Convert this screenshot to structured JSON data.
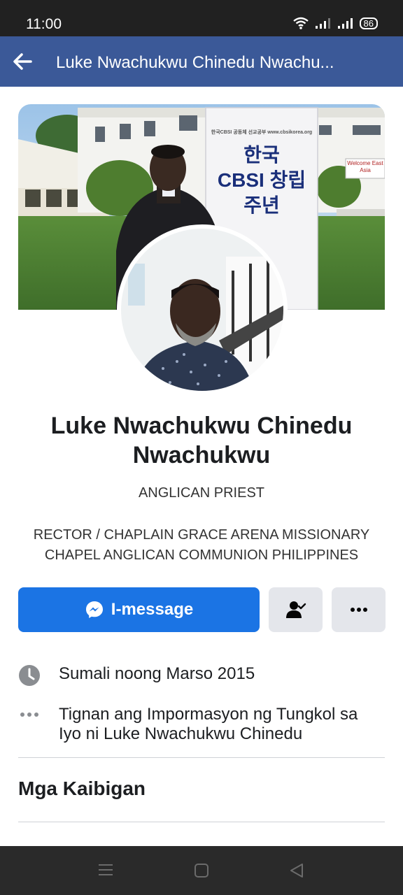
{
  "status_bar": {
    "time": "11:00",
    "battery": "86"
  },
  "header": {
    "title": "Luke Nwachukwu Chinedu Nwachu..."
  },
  "cover": {
    "sign_line1": "한국",
    "sign_line2": "CBSI 창립",
    "sign_line3": "주년",
    "sign_top": "한국CBSI 공동체 선교공부   www.cbsikorea.org",
    "building_sign": "Welcome East Asia"
  },
  "profile": {
    "name": "Luke Nwachukwu Chinedu Nwachukwu",
    "subtitle": "ANGLICAN PRIEST",
    "bio": "RECTOR / CHAPLAIN GRACE ARENA MISSIONARY CHAPEL ANGLICAN COMMUNION PHILIPPINES"
  },
  "actions": {
    "message_label": "I-message"
  },
  "info": [
    {
      "icon": "clock-icon",
      "text": "Sumali noong Marso 2015"
    },
    {
      "icon": "more-dots-icon",
      "text": "Tignan ang Impormasyon ng Tungkol sa Iyo ni Luke Nwachukwu Chinedu"
    }
  ],
  "sections": {
    "friends_title": "Mga Kaibigan"
  },
  "colors": {
    "header": "#3b5998",
    "message_button": "#1b74e4",
    "secondary_button": "#e4e6eb"
  }
}
